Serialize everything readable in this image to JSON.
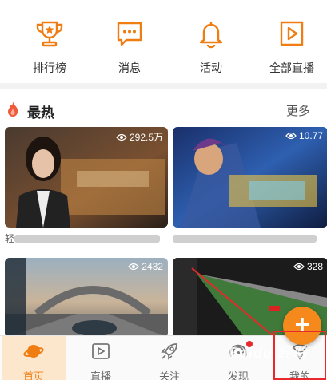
{
  "topnav": {
    "items": [
      {
        "label": "排行榜",
        "icon": "trophy-icon"
      },
      {
        "label": "消息",
        "icon": "message-icon"
      },
      {
        "label": "活动",
        "icon": "bell-icon"
      },
      {
        "label": "全部直播",
        "icon": "video-play-icon"
      }
    ]
  },
  "hot": {
    "title": "最热",
    "more": "更多",
    "cards": [
      {
        "views": "292.5万",
        "caption": "轻"
      },
      {
        "views": "10.77",
        "caption": ""
      },
      {
        "views": "2432",
        "caption": ""
      },
      {
        "views": "328",
        "caption": ""
      }
    ]
  },
  "tabbar": {
    "items": [
      {
        "label": "首页",
        "icon": "planet-icon",
        "active": true
      },
      {
        "label": "直播",
        "icon": "play-box-icon",
        "active": false
      },
      {
        "label": "关注",
        "icon": "rocket-icon",
        "active": false
      },
      {
        "label": "发现",
        "icon": "radar-icon",
        "active": false
      },
      {
        "label": "我的",
        "icon": "person-icon",
        "active": false
      }
    ]
  },
  "fab": {
    "label": "+"
  },
  "watermark": "Baidu 经验",
  "colors": {
    "accent": "#f07d12",
    "fab": "#f5891c",
    "highlight": "#e8282b"
  }
}
